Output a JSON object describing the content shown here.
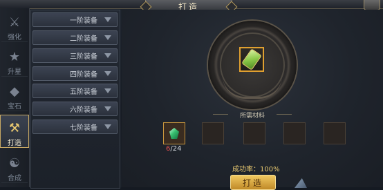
{
  "window": {
    "title": "打造"
  },
  "tabs": [
    {
      "label": "强化",
      "icon": "strengthen-icon"
    },
    {
      "label": "升星",
      "icon": "star-icon"
    },
    {
      "label": "宝石",
      "icon": "gem-icon"
    },
    {
      "label": "打造",
      "icon": "hammer-icon",
      "active": true
    },
    {
      "label": "合成",
      "icon": "yin-yang-icon"
    }
  ],
  "equipment_list": [
    {
      "label": "一阶装备"
    },
    {
      "label": "二阶装备"
    },
    {
      "label": "三阶装备"
    },
    {
      "label": "四阶装备"
    },
    {
      "label": "五阶装备"
    },
    {
      "label": "六阶装备"
    },
    {
      "label": "七阶装备"
    }
  ],
  "forge": {
    "target_item_icon": "scroll-icon",
    "materials_title": "所需材料",
    "material_count_current": "6",
    "material_count_sep": "/",
    "material_count_required": "24",
    "success_rate": "成功率：100%",
    "forge_button": "打造"
  },
  "colors": {
    "accent_gold": "#e8c870",
    "slot_border": "#e0a030",
    "count_red": "#e05050"
  }
}
